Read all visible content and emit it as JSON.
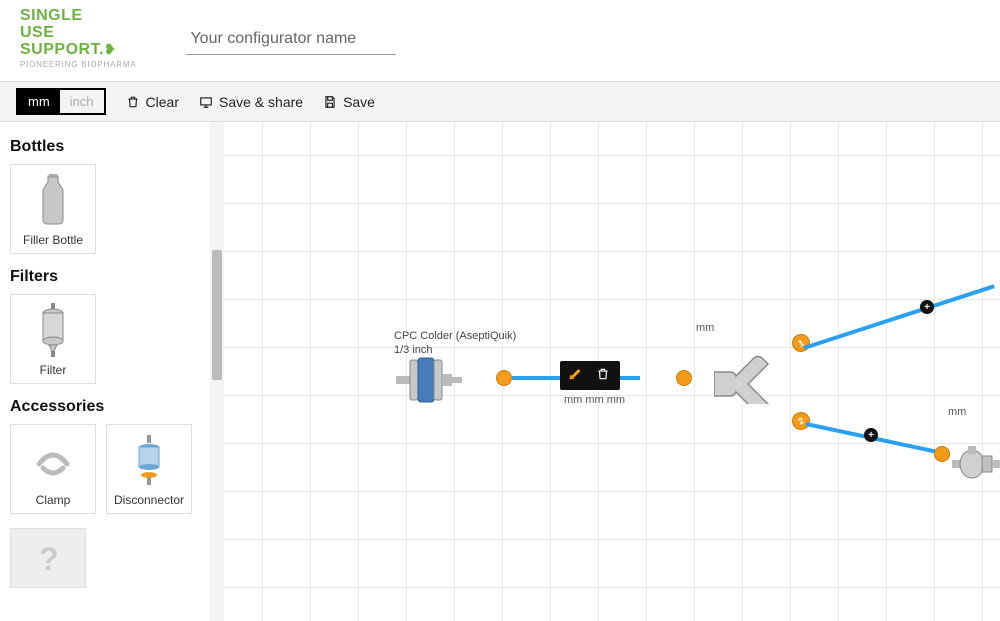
{
  "app": {
    "logo_lines": [
      "SINGLE",
      "USE",
      "SUPPORT."
    ],
    "logo_tagline": "PIONEERING BIOPHARMA",
    "name_placeholder": "Your configurator name"
  },
  "toolbar": {
    "unit_mm": "mm",
    "unit_inch": "inch",
    "clear": "Clear",
    "save_share": "Save & share",
    "save": "Save"
  },
  "sidebar": {
    "categories": [
      {
        "title": "Bottles",
        "items": [
          {
            "id": "filler-bottle",
            "label": "Filler Bottle"
          }
        ]
      },
      {
        "title": "Filters",
        "items": [
          {
            "id": "filter",
            "label": "Filter"
          }
        ]
      },
      {
        "title": "Accessories",
        "items": [
          {
            "id": "clamp",
            "label": "Clamp"
          },
          {
            "id": "disconnector",
            "label": "Disconnector"
          }
        ]
      }
    ]
  },
  "canvas": {
    "selected_node": {
      "title": "CPC Colder (AseptiQuik)",
      "subtitle": "1/3 inch"
    },
    "tube_dims_label": "mm mm mm",
    "mm_labels": [
      "mm",
      "mm"
    ],
    "branch_numbers": [
      "1",
      "2"
    ],
    "plus": "+"
  }
}
